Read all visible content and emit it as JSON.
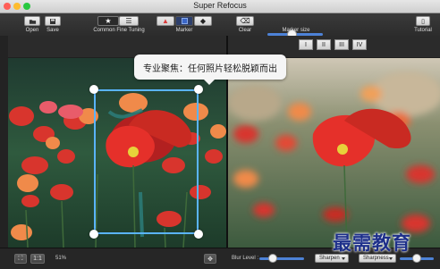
{
  "window": {
    "title": "Super Refocus"
  },
  "toolbar": {
    "open_label": "Open",
    "save_label": "Save",
    "mode_labels": "Common  Fine Tuning",
    "marker_label": "Marker",
    "clear_label": "Clear",
    "marker_size_label": "Marker size",
    "tutorial_label": "Tutorial"
  },
  "view_tabs": [
    "I",
    "II",
    "III",
    "IV"
  ],
  "tooltip": {
    "text": "专业聚焦：任何照片轻松脱颖而出"
  },
  "bottom": {
    "zoom": "51%",
    "actual_size": "1:1",
    "blur_level_label": "Blur Level :",
    "sharpen_option": "Sharpen",
    "sharpness_option": "Sharpness"
  },
  "watermark": "最需教育",
  "colors": {
    "accent": "#4d82d7",
    "focus_border": "#5ab4ff",
    "marker_red": "#d93b3b"
  },
  "icons": {
    "open": "open-icon",
    "save": "save-icon",
    "common": "star-icon",
    "fine_tuning": "lines-icon",
    "marker_add": "red-triangle-icon",
    "marker_mode": "square-icon",
    "marker_erase": "diamond-icon",
    "clear": "eraser-icon",
    "tutorial": "book-icon",
    "fit": "fit-screen-icon",
    "move": "move-arrows-icon"
  }
}
